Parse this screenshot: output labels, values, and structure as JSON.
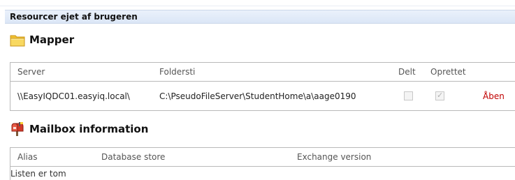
{
  "section": {
    "title": "Resourcer ejet af brugeren"
  },
  "folders": {
    "title": "Mapper",
    "icon": "folder-icon",
    "columns": {
      "server": "Server",
      "path": "Foldersti",
      "shared": "Delt",
      "created": "Oprettet"
    },
    "rows": [
      {
        "server": "\\\\EasyIQDC01.easyiq.local\\",
        "path": "C:\\PseudoFileServer\\StudentHome\\a\\aage0190",
        "shared": false,
        "created": true,
        "action": "Åben"
      }
    ]
  },
  "mailbox": {
    "title": "Mailbox information",
    "icon": "mailbox-icon",
    "columns": {
      "alias": "Alias",
      "database": "Database store",
      "exchange": "Exchange version"
    },
    "empty_text": "Listen er tom"
  },
  "colors": {
    "header_bg": "#dbe6f6",
    "link_red": "#c00000",
    "border": "#b9b9b9"
  }
}
